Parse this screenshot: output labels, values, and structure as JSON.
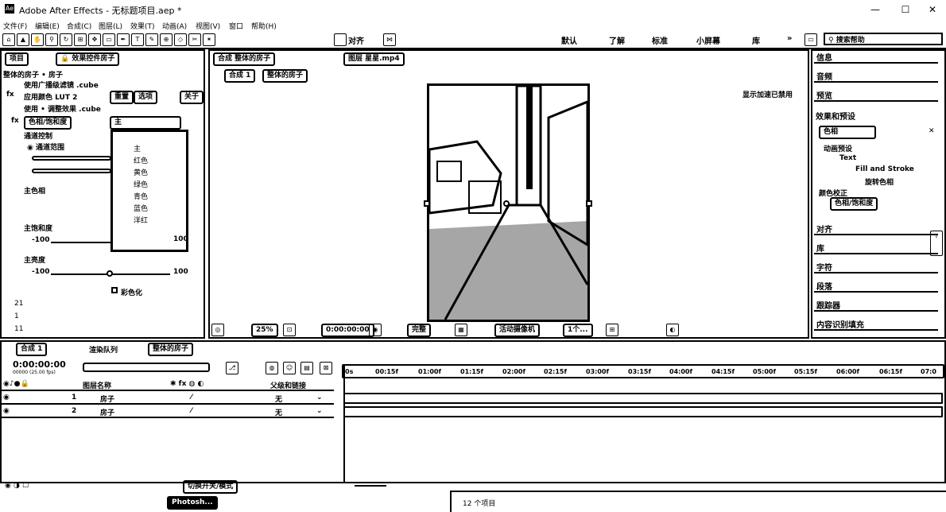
{
  "window": {
    "title": "Adobe After Effects - 无标题项目.aep *",
    "app_icon": "Ae",
    "minimize": "—",
    "maximize": "☐",
    "close": "✕"
  },
  "menu": [
    "文件(F)",
    "编辑(E)",
    "合成(C)",
    "图层(L)",
    "效果(T)",
    "动画(A)",
    "视图(V)",
    "窗口",
    "帮助(H)"
  ],
  "toolbar": {
    "align_label": "对齐",
    "workspaces": [
      "默认",
      "了解",
      "标准",
      "小屏幕",
      "库"
    ],
    "more": "»",
    "search_placeholder": "搜索帮助"
  },
  "left_panel": {
    "tab_project": "项目",
    "tab_effects": "效果控件房子",
    "layer_path": "整体的房子 • 房子",
    "lines": [
      "使用广播级滤镜 .cube",
      "应用颜色 LUT 2",
      "使用 • 调整效果 .cube",
      "色相/饱和度",
      "通道控制"
    ],
    "buttons": [
      "重置",
      "选项",
      "关于"
    ],
    "master_hue": "主色相",
    "master_saturation": "主饱和度",
    "master_lightness": "主亮度",
    "sat_min": "-100",
    "sat_max": "100",
    "light_min": "-100",
    "light_max": "100",
    "colorize": "彩色化",
    "channel_value": "主",
    "dropdown_range_max": "100",
    "dropdown_options": [
      "主",
      "红色",
      "黄色",
      "绿色",
      "青色",
      "蓝色",
      "洋红"
    ],
    "bottom_rows": [
      "21",
      "1",
      "11"
    ]
  },
  "comp_panel": {
    "tab_comp": "合成 整体的房子",
    "tab_layer": "图层 星星.mp4",
    "crumb_1": "合成 1",
    "crumb_2": "整体的房子",
    "layer_label": "显示加速已禁用",
    "footer": {
      "zoom": "25%",
      "timecode": "0:00:00:00",
      "quality": "完整",
      "camera": "活动摄像机",
      "views": "1个..."
    }
  },
  "right_panel": {
    "items_top": [
      "信息",
      "音频",
      "预览"
    ],
    "effects_presets": "效果和预设",
    "search_value": "色相",
    "tree": [
      "动画预设",
      "Text",
      "Fill and Stroke",
      "旋转色相"
    ],
    "color_correction": "颜色校正",
    "tree_item_hue": "色相/饱和度",
    "items_bottom": [
      "对齐",
      "库",
      "字符",
      "段落",
      "跟踪器",
      "内容识别填充"
    ]
  },
  "timeline": {
    "tabs": [
      "合成 1",
      "渲染队列",
      "整体的房子"
    ],
    "timecode": "0:00:00:00",
    "sub_timecode": "00000 (25.00 fps)",
    "col_layer_name": "图层名称",
    "col_parent": "父级和链接",
    "layers": [
      {
        "num": "1",
        "name": "房子",
        "parent": "无"
      },
      {
        "num": "2",
        "name": "房子",
        "parent": "无"
      }
    ],
    "ruler": [
      "0s",
      "00:15f",
      "01:00f",
      "01:15f",
      "02:00f",
      "02:15f",
      "03:00f",
      "03:15f",
      "04:00f",
      "04:15f",
      "05:00f",
      "05:15f",
      "06:00f",
      "06:15f",
      "07:0"
    ],
    "footer_label": "切换开关/模式",
    "taskbar_label": "Photosh..."
  },
  "status": {
    "items": "12 个项目"
  }
}
